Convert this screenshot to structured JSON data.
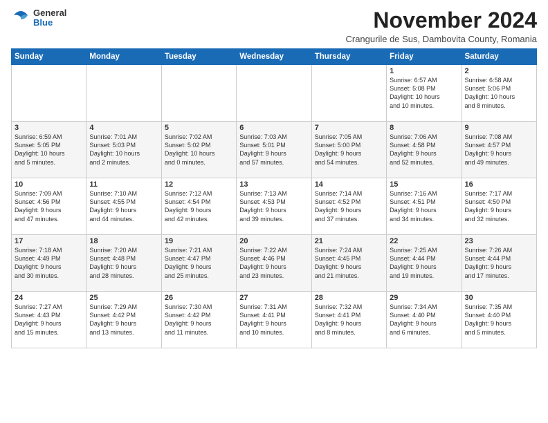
{
  "logo": {
    "general": "General",
    "blue": "Blue"
  },
  "header": {
    "title": "November 2024",
    "subtitle": "Crangurile de Sus, Dambovita County, Romania"
  },
  "weekdays": [
    "Sunday",
    "Monday",
    "Tuesday",
    "Wednesday",
    "Thursday",
    "Friday",
    "Saturday"
  ],
  "weeks": [
    [
      {
        "day": "",
        "info": ""
      },
      {
        "day": "",
        "info": ""
      },
      {
        "day": "",
        "info": ""
      },
      {
        "day": "",
        "info": ""
      },
      {
        "day": "",
        "info": ""
      },
      {
        "day": "1",
        "info": "Sunrise: 6:57 AM\nSunset: 5:08 PM\nDaylight: 10 hours\nand 10 minutes."
      },
      {
        "day": "2",
        "info": "Sunrise: 6:58 AM\nSunset: 5:06 PM\nDaylight: 10 hours\nand 8 minutes."
      }
    ],
    [
      {
        "day": "3",
        "info": "Sunrise: 6:59 AM\nSunset: 5:05 PM\nDaylight: 10 hours\nand 5 minutes."
      },
      {
        "day": "4",
        "info": "Sunrise: 7:01 AM\nSunset: 5:03 PM\nDaylight: 10 hours\nand 2 minutes."
      },
      {
        "day": "5",
        "info": "Sunrise: 7:02 AM\nSunset: 5:02 PM\nDaylight: 10 hours\nand 0 minutes."
      },
      {
        "day": "6",
        "info": "Sunrise: 7:03 AM\nSunset: 5:01 PM\nDaylight: 9 hours\nand 57 minutes."
      },
      {
        "day": "7",
        "info": "Sunrise: 7:05 AM\nSunset: 5:00 PM\nDaylight: 9 hours\nand 54 minutes."
      },
      {
        "day": "8",
        "info": "Sunrise: 7:06 AM\nSunset: 4:58 PM\nDaylight: 9 hours\nand 52 minutes."
      },
      {
        "day": "9",
        "info": "Sunrise: 7:08 AM\nSunset: 4:57 PM\nDaylight: 9 hours\nand 49 minutes."
      }
    ],
    [
      {
        "day": "10",
        "info": "Sunrise: 7:09 AM\nSunset: 4:56 PM\nDaylight: 9 hours\nand 47 minutes."
      },
      {
        "day": "11",
        "info": "Sunrise: 7:10 AM\nSunset: 4:55 PM\nDaylight: 9 hours\nand 44 minutes."
      },
      {
        "day": "12",
        "info": "Sunrise: 7:12 AM\nSunset: 4:54 PM\nDaylight: 9 hours\nand 42 minutes."
      },
      {
        "day": "13",
        "info": "Sunrise: 7:13 AM\nSunset: 4:53 PM\nDaylight: 9 hours\nand 39 minutes."
      },
      {
        "day": "14",
        "info": "Sunrise: 7:14 AM\nSunset: 4:52 PM\nDaylight: 9 hours\nand 37 minutes."
      },
      {
        "day": "15",
        "info": "Sunrise: 7:16 AM\nSunset: 4:51 PM\nDaylight: 9 hours\nand 34 minutes."
      },
      {
        "day": "16",
        "info": "Sunrise: 7:17 AM\nSunset: 4:50 PM\nDaylight: 9 hours\nand 32 minutes."
      }
    ],
    [
      {
        "day": "17",
        "info": "Sunrise: 7:18 AM\nSunset: 4:49 PM\nDaylight: 9 hours\nand 30 minutes."
      },
      {
        "day": "18",
        "info": "Sunrise: 7:20 AM\nSunset: 4:48 PM\nDaylight: 9 hours\nand 28 minutes."
      },
      {
        "day": "19",
        "info": "Sunrise: 7:21 AM\nSunset: 4:47 PM\nDaylight: 9 hours\nand 25 minutes."
      },
      {
        "day": "20",
        "info": "Sunrise: 7:22 AM\nSunset: 4:46 PM\nDaylight: 9 hours\nand 23 minutes."
      },
      {
        "day": "21",
        "info": "Sunrise: 7:24 AM\nSunset: 4:45 PM\nDaylight: 9 hours\nand 21 minutes."
      },
      {
        "day": "22",
        "info": "Sunrise: 7:25 AM\nSunset: 4:44 PM\nDaylight: 9 hours\nand 19 minutes."
      },
      {
        "day": "23",
        "info": "Sunrise: 7:26 AM\nSunset: 4:44 PM\nDaylight: 9 hours\nand 17 minutes."
      }
    ],
    [
      {
        "day": "24",
        "info": "Sunrise: 7:27 AM\nSunset: 4:43 PM\nDaylight: 9 hours\nand 15 minutes."
      },
      {
        "day": "25",
        "info": "Sunrise: 7:29 AM\nSunset: 4:42 PM\nDaylight: 9 hours\nand 13 minutes."
      },
      {
        "day": "26",
        "info": "Sunrise: 7:30 AM\nSunset: 4:42 PM\nDaylight: 9 hours\nand 11 minutes."
      },
      {
        "day": "27",
        "info": "Sunrise: 7:31 AM\nSunset: 4:41 PM\nDaylight: 9 hours\nand 10 minutes."
      },
      {
        "day": "28",
        "info": "Sunrise: 7:32 AM\nSunset: 4:41 PM\nDaylight: 9 hours\nand 8 minutes."
      },
      {
        "day": "29",
        "info": "Sunrise: 7:34 AM\nSunset: 4:40 PM\nDaylight: 9 hours\nand 6 minutes."
      },
      {
        "day": "30",
        "info": "Sunrise: 7:35 AM\nSunset: 4:40 PM\nDaylight: 9 hours\nand 5 minutes."
      }
    ]
  ]
}
